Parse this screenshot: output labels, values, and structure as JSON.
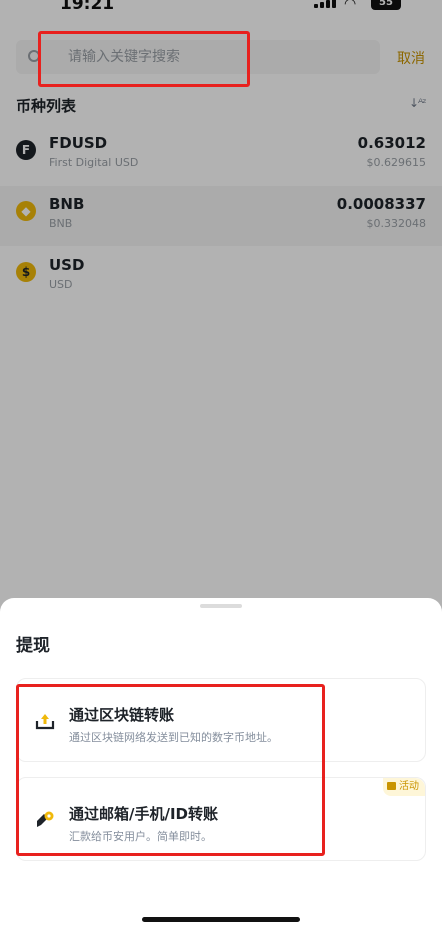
{
  "status_bar": {
    "time": "19:21",
    "battery": "55"
  },
  "search": {
    "placeholder": "请输入关键字搜索",
    "cancel_label": "取消"
  },
  "list": {
    "title": "币种列表",
    "coins": [
      {
        "symbol": "FDUSD",
        "name": "First Digital USD",
        "amount": "0.63012",
        "value": "$0.629615",
        "icon_glyph": "F",
        "icon_bg": "#1e2329",
        "icon_color": "#ffffff"
      },
      {
        "symbol": "BNB",
        "name": "BNB",
        "amount": "0.0008337",
        "value": "$0.332048",
        "icon_glyph": "◆",
        "icon_bg": "#f0b90b",
        "icon_color": "#ffffff"
      },
      {
        "symbol": "USD",
        "name": "USD",
        "amount": "",
        "value": "",
        "icon_glyph": "$",
        "icon_bg": "#f0b90b",
        "icon_color": "#1e2329"
      }
    ]
  },
  "sheet": {
    "title": "提现",
    "options": [
      {
        "title": "通过区块链转账",
        "description": "通过区块链网络发送到已知的数字币地址。",
        "icon": "upload-icon"
      },
      {
        "title": "通过邮箱/手机/ID转账",
        "description": "汇款给币安用户。简单即时。",
        "icon": "send-pay-icon",
        "badge": "活动"
      }
    ]
  },
  "colors": {
    "accent": "#c99400",
    "highlight": "#e8211e",
    "brand_yellow": "#f0b90b"
  }
}
